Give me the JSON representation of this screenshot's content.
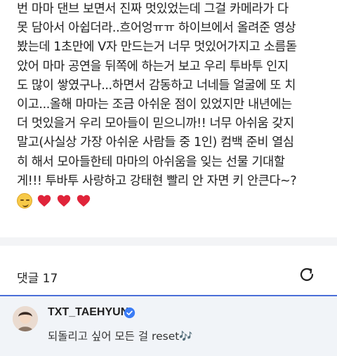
{
  "post": {
    "lines": [
      "번 마마 댄브 보면서 진짜 멋있었는데 그걸 카메라가 다",
      "못 담아서 아쉽더라..흐어엉ㅠㅠ 하이브에서 올려준 영상",
      "봤는데 1초만에 V자 만드는거 너무 멋있어가지고 소름돋",
      "았어 마마 공연을 뒤쪽에 하는거 보고 우리 투바투 인지",
      "도 많이 쌓였구나...하면서 감동하고 너네들 얼굴에 또 치",
      "이고...올해 마마는 조금 아쉬운 점이 있었지만 내년에는",
      "더 멋있을거 우리 모아들이 믿으니까!! 너무 아쉬움 갖지",
      "말고(사실상 가장 아쉬운 사람들 중 1인) 컴백 준비 열심",
      "히 해서 모아들한테 마마의 아쉬움을 잊는 선물 기대할",
      "게!!! 투바투 사랑하고 강태현 빨리 안 자면 키 안큰다~?"
    ],
    "emojis": [
      "smirk-icon",
      "heart-icon",
      "heart-icon",
      "heart-icon"
    ]
  },
  "comments": {
    "label": "댓글 17",
    "refresh_icon": "refresh-icon"
  },
  "comment": {
    "username": "TXT_TAEHYUN",
    "verified_icon": "verified-badge-icon",
    "text": "되돌리고 싶어 모든 걸 reset🎶"
  },
  "colors": {
    "accent": "#4b6fd8",
    "heart": "#e0243a",
    "verified": "#3b7cf5",
    "card_bg": "#f1f4f8"
  }
}
